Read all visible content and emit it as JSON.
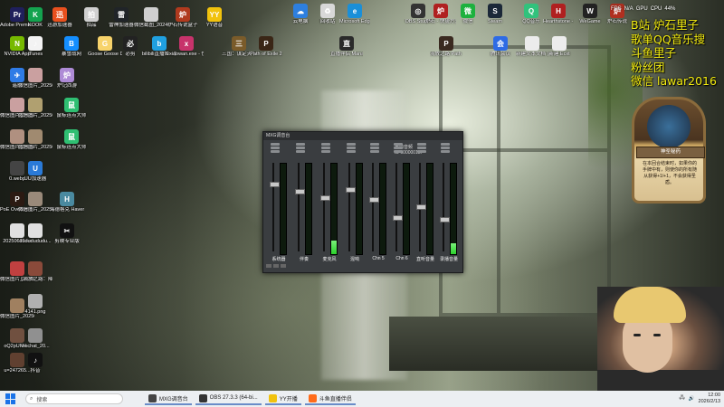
{
  "desktop_icons": [
    {
      "label": "Adobe Premie...",
      "icon": "premiere-icon",
      "color": "#1f1f5c",
      "glyph": "Pr"
    },
    {
      "label": "KOOK",
      "icon": "kook-icon",
      "color": "#14a34f",
      "glyph": "K"
    },
    {
      "label": "迅游加速器",
      "icon": "xunyou-icon",
      "color": "#e8501e",
      "glyph": "迅"
    },
    {
      "label": "拍品",
      "icon": "paipin-icon",
      "color": "#d0d0d0",
      "glyph": "拍"
    },
    {
      "label": "雷神加速器",
      "icon": "leishen-icon",
      "color": "#202428",
      "glyph": "雷"
    },
    {
      "label": "微信截图_2024071...",
      "icon": "image-file-icon",
      "color": "#cfcfcf",
      "glyph": ""
    },
    {
      "label": "炉石传说盒子",
      "icon": "hearthstone-box-icon",
      "color": "#b03a1e",
      "glyph": "炉"
    },
    {
      "label": "YY语音",
      "icon": "yy-icon",
      "color": "#f1c20d",
      "glyph": "YY"
    },
    {
      "label": "NVIDIA App",
      "icon": "nvidia-icon",
      "color": "#76b900",
      "glyph": "N"
    },
    {
      "label": "iTunes",
      "icon": "itunes-icon",
      "color": "#f3f3f3",
      "glyph": "♪"
    },
    {
      "label": "暴雪战网",
      "icon": "battlenet-icon",
      "color": "#148eff",
      "glyph": "B"
    },
    {
      "label": "Goose Goose Duck",
      "icon": "goose-icon",
      "color": "#f7d36b",
      "glyph": "G"
    },
    {
      "label": "必剪",
      "icon": "bijian-icon",
      "color": "#222",
      "glyph": "必"
    },
    {
      "label": "bilibili直播姬 - 快捷方式",
      "icon": "bilibili-icon",
      "color": "#20a0e0",
      "glyph": "b"
    },
    {
      "label": "xiaowan.exe - 快捷方式",
      "icon": "exe-icon",
      "color": "#c7336b",
      "glyph": "x"
    },
    {
      "label": "三国：谋定天下",
      "icon": "sanguo-icon",
      "color": "#7a5b2a",
      "glyph": "三"
    },
    {
      "label": "Path of Exile 2",
      "icon": "poe2-icon",
      "color": "#3a2616",
      "glyph": "P"
    },
    {
      "label": "遥感",
      "icon": "remote-icon",
      "color": "#2f7be6",
      "glyph": "✈"
    },
    {
      "label": "微信图片_2025072...",
      "icon": "image-file-icon",
      "color": "#caa0a0",
      "glyph": ""
    },
    {
      "label": "炉记西游",
      "icon": "luji-icon",
      "color": "#ae8bd6",
      "glyph": "炉"
    },
    {
      "label": "微信图片_2025080...",
      "icon": "image-file-icon",
      "color": "#caa0a0",
      "glyph": ""
    },
    {
      "label": "微信图片_2025072...",
      "icon": "image-file-icon",
      "color": "#b0a070",
      "glyph": ""
    },
    {
      "label": "鼠标连点大师",
      "icon": "clicker-icon",
      "color": "#2fbf72",
      "glyph": "鼠"
    },
    {
      "label": "微信图片_2025071...",
      "icon": "image-file-icon",
      "color": "#b09080",
      "glyph": ""
    },
    {
      "label": "微信图片_2025072...",
      "icon": "image-file-icon",
      "color": "#a08a70",
      "glyph": ""
    },
    {
      "label": "鼠标连点大师",
      "icon": "clicker-icon",
      "color": "#2fbf72",
      "glyph": "鼠"
    },
    {
      "label": "0.webp",
      "icon": "image-file-icon",
      "color": "#444",
      "glyph": ""
    },
    {
      "label": "UU加速器",
      "icon": "uu-icon",
      "color": "#2a7ad8",
      "glyph": "U"
    },
    {
      "label": "PoE Overlay II Standal...",
      "icon": "poe-overlay-icon",
      "color": "#2b1a12",
      "glyph": "P"
    },
    {
      "label": "微信图片_2025073...",
      "icon": "image-file-icon",
      "color": "#9a8a7a",
      "glyph": ""
    },
    {
      "label": "海德格克 Havendock",
      "icon": "havendock-icon",
      "color": "#4a8aa0",
      "glyph": "H"
    },
    {
      "label": "20250625.kx",
      "icon": "file-icon",
      "color": "#e0e0e0",
      "glyph": ""
    },
    {
      "label": "dududududu...",
      "icon": "file-icon",
      "color": "#e0e0e0",
      "glyph": ""
    },
    {
      "label": "剪映专业版",
      "icon": "capcut-icon",
      "color": "#111",
      "glyph": "✂"
    },
    {
      "label": "微信图片_2025062...",
      "icon": "image-file-icon",
      "color": "#c04040",
      "glyph": ""
    },
    {
      "label": "《流放之路：降临》预先...",
      "icon": "image-file-icon",
      "color": "#8a4a3a",
      "glyph": ""
    },
    {
      "label": "4141.png",
      "icon": "image-file-icon",
      "color": "#b0b0b0",
      "glyph": ""
    },
    {
      "label": "微信图片_2025091...",
      "icon": "image-file-icon",
      "color": "#a08060",
      "glyph": ""
    },
    {
      "label": "oQ2pUFN...",
      "icon": "image-file-icon",
      "color": "#705040",
      "glyph": ""
    },
    {
      "label": "wechat_20...",
      "icon": "image-file-icon",
      "color": "#909090",
      "glyph": ""
    },
    {
      "label": "u=247265...",
      "icon": "image-file-icon",
      "color": "#604030",
      "glyph": ""
    },
    {
      "label": "抖音",
      "icon": "douyin-icon",
      "color": "#111",
      "glyph": "♪"
    }
  ],
  "top_icons": [
    {
      "label": "云电脑",
      "icon": "cloud-pc-icon",
      "color": "#2d7fe0",
      "glyph": "☁"
    },
    {
      "label": "回收站",
      "icon": "recycle-bin-icon",
      "color": "#d8d8d8",
      "glyph": "♻"
    },
    {
      "label": "Microsoft Edge",
      "icon": "edge-icon",
      "color": "#1a8fd8",
      "glyph": "e"
    },
    {
      "label": "OBS Studio",
      "icon": "obs-icon",
      "color": "#333",
      "glyph": "◎"
    },
    {
      "label": "炉石 - 快捷方式",
      "icon": "hearthstone-icon",
      "color": "#b02020",
      "glyph": "炉"
    },
    {
      "label": "微信",
      "icon": "wechat-icon",
      "color": "#1db13e",
      "glyph": "微"
    },
    {
      "label": "Steam",
      "icon": "steam-icon",
      "color": "#1b2838",
      "glyph": "S"
    },
    {
      "label": "QQ音乐",
      "icon": "qqmusic-icon",
      "color": "#31c27c",
      "glyph": "Q"
    },
    {
      "label": "Hearthstone - 快捷方式",
      "icon": "hearthstone-icon",
      "color": "#b02020",
      "glyph": "H"
    },
    {
      "label": "WeGame",
      "icon": "wegame-icon",
      "color": "#222",
      "glyph": "W"
    },
    {
      "label": "炉石传说",
      "icon": "hearthstone-icon",
      "color": "#b03020",
      "glyph": "炉"
    }
  ],
  "second_row_icons": [
    {
      "label": "直播伴侣 Manager...",
      "icon": "live-assistant-icon",
      "color": "#2a2a2a",
      "glyph": "直"
    },
    {
      "label": "流放之路 Path of...",
      "icon": "poe-icon",
      "color": "#3a2a20",
      "glyph": "P"
    },
    {
      "label": "腾讯会议",
      "icon": "tencent-meeting-icon",
      "color": "#2e6be5",
      "glyph": "会"
    },
    {
      "label": "新建文本文档 (2).txt",
      "icon": "text-file-icon",
      "color": "#ececec",
      "glyph": ""
    },
    {
      "label": "新建 Ecxt",
      "icon": "text-file-icon",
      "color": "#ececec",
      "glyph": ""
    }
  ],
  "overlay": {
    "lines": [
      "B站 炉石里子",
      "歌单QQ音乐搜",
      "斗鱼里子",
      "粉丝团",
      "微信  lawar2016"
    ],
    "card_banner": "神圣秘药",
    "card_text": "在本回合结束时，如果你的手牌中有，则使你的所有随从获得+1/+1，不会获得圣盾。"
  },
  "topbar": {
    "fps_label": "FPS",
    "fps_value": "N/A",
    "gpu_label": "GPU",
    "cpu_label": "CPU",
    "cpu_value": "44%"
  },
  "mixer": {
    "title": "MXG调音台",
    "info_label": "当前音频",
    "info_value": "ID 000000187",
    "channels": [
      {
        "label": "系统器",
        "level": 0.0,
        "fader": 0.78
      },
      {
        "label": "伴奏",
        "level": 0.0,
        "fader": 0.7
      },
      {
        "label": "麦克风",
        "level": 0.15,
        "fader": 0.62
      },
      {
        "label": "混响",
        "level": 0.0,
        "fader": 0.72
      },
      {
        "label": "Chn 5",
        "level": 0.0,
        "fader": 0.6
      },
      {
        "label": "Chn 6",
        "level": 0.0,
        "fader": 0.4
      },
      {
        "label": "直听音量",
        "level": 0.0,
        "fader": 0.52
      },
      {
        "label": "录播音量",
        "level": 0.12,
        "fader": 0.38
      }
    ]
  },
  "taskbar": {
    "search_placeholder": "搜索",
    "tasks": [
      {
        "label": "MXG调音台",
        "icon": "mixer-app-icon",
        "color": "#444"
      },
      {
        "label": "OBS 27.3.3 (64-bi...",
        "icon": "obs-icon",
        "color": "#333"
      },
      {
        "label": "YY开播",
        "icon": "yy-icon",
        "color": "#f1c20d"
      },
      {
        "label": "斗鱼直播伴侣",
        "icon": "douyu-icon",
        "color": "#ff6b1a"
      }
    ],
    "time": "12:00",
    "date": "2026/2/13"
  }
}
